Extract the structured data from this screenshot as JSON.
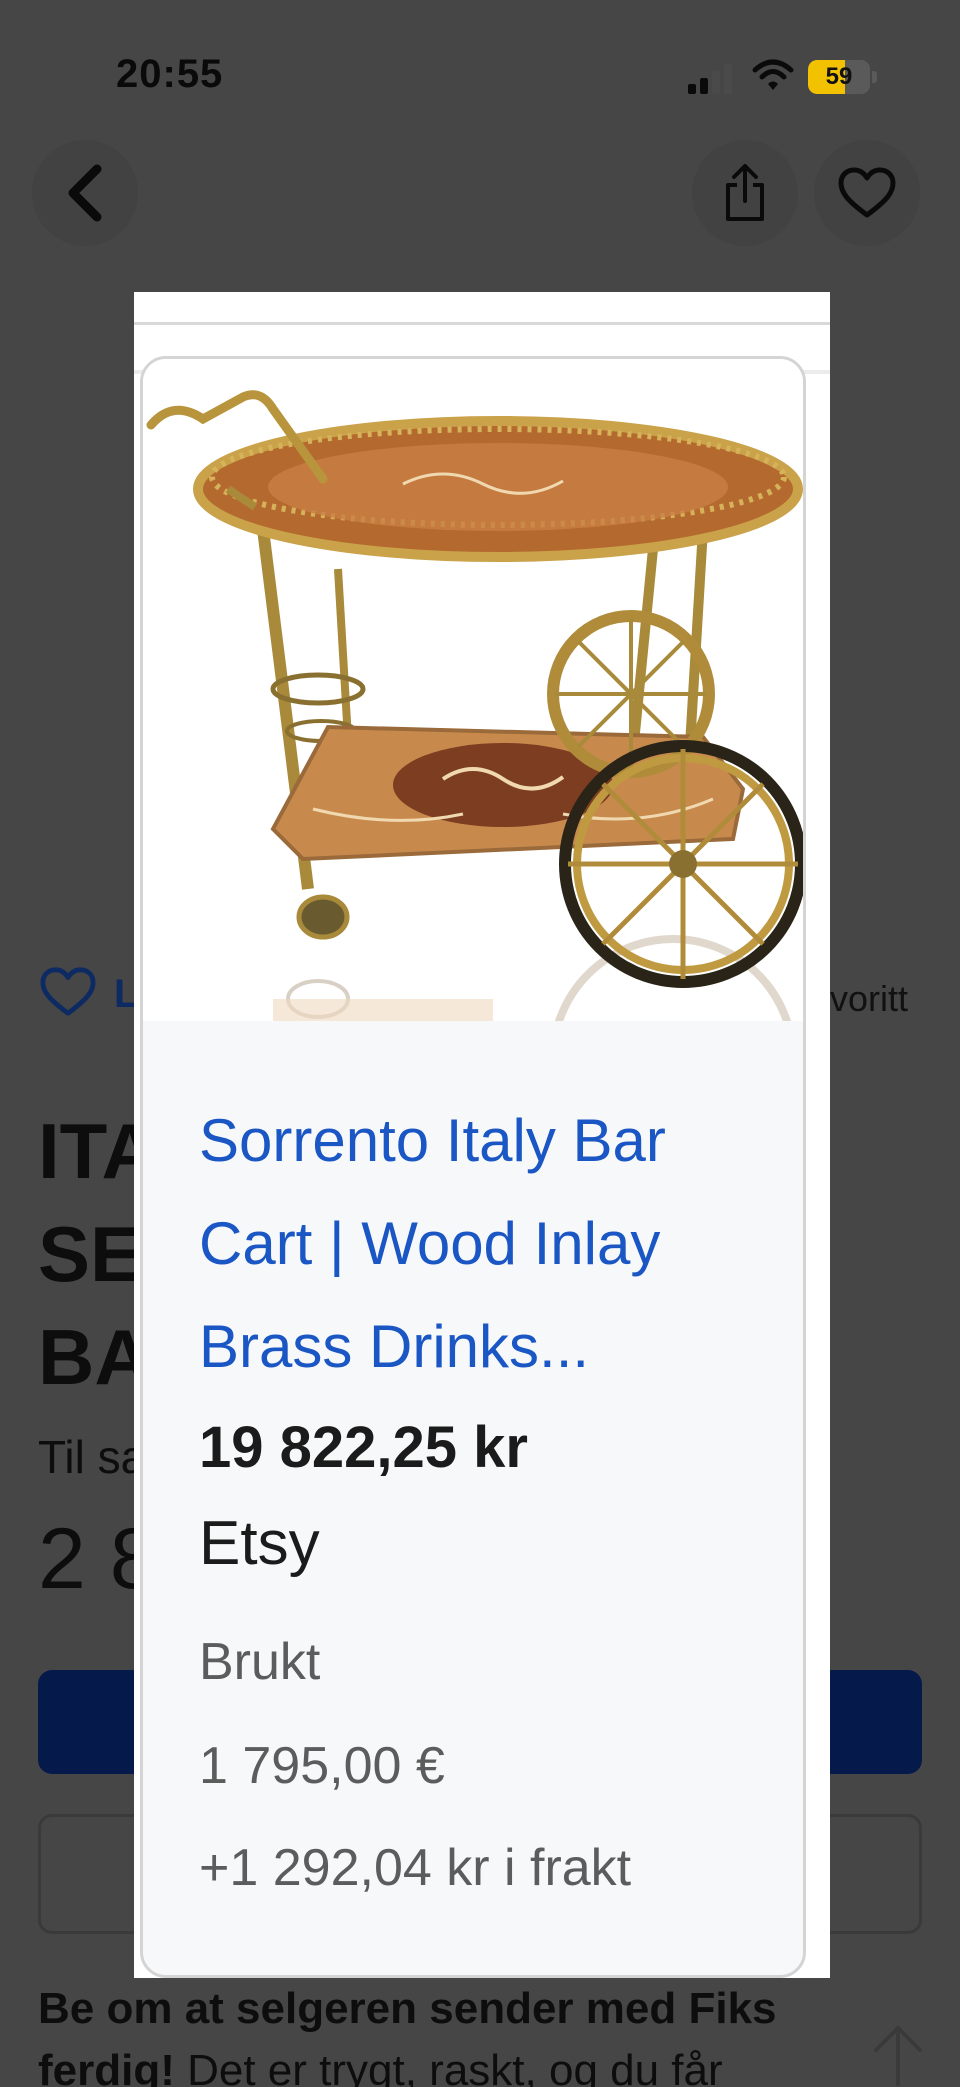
{
  "status_bar": {
    "time": "20:55",
    "battery_level": "59",
    "battery_fraction": 0.59,
    "icons": [
      "signal-icon",
      "wifi-icon",
      "battery-icon"
    ]
  },
  "nav": {
    "icons": [
      "chevron-left-icon",
      "share-icon",
      "heart-icon"
    ]
  },
  "background_page": {
    "favorite_left": "L",
    "favorite_right": "voritt",
    "title_lines": [
      "ITA",
      "SE",
      "BA"
    ],
    "sale_label": "Til sa",
    "price_partial": "2 8",
    "bottom_text_bold": "Be om at selgeren sender med Fiks ferdig!",
    "bottom_text_regular": " Det er trygt, raskt, og du får"
  },
  "card": {
    "title": "Sorrento Italy Bar Cart | Wood Inlay Brass Drinks...",
    "price": "19 822,25 kr",
    "source": "Etsy",
    "condition": "Brukt",
    "original_price": "1 795,00 €",
    "shipping": "+1 292,04 kr i frakt",
    "image_icon": "bar-cart-image"
  },
  "colors": {
    "link_blue": "#1a56c4",
    "navy_button": "#051a4a",
    "battery_yellow": "#f2c200",
    "overlay_dim": "#464646"
  }
}
